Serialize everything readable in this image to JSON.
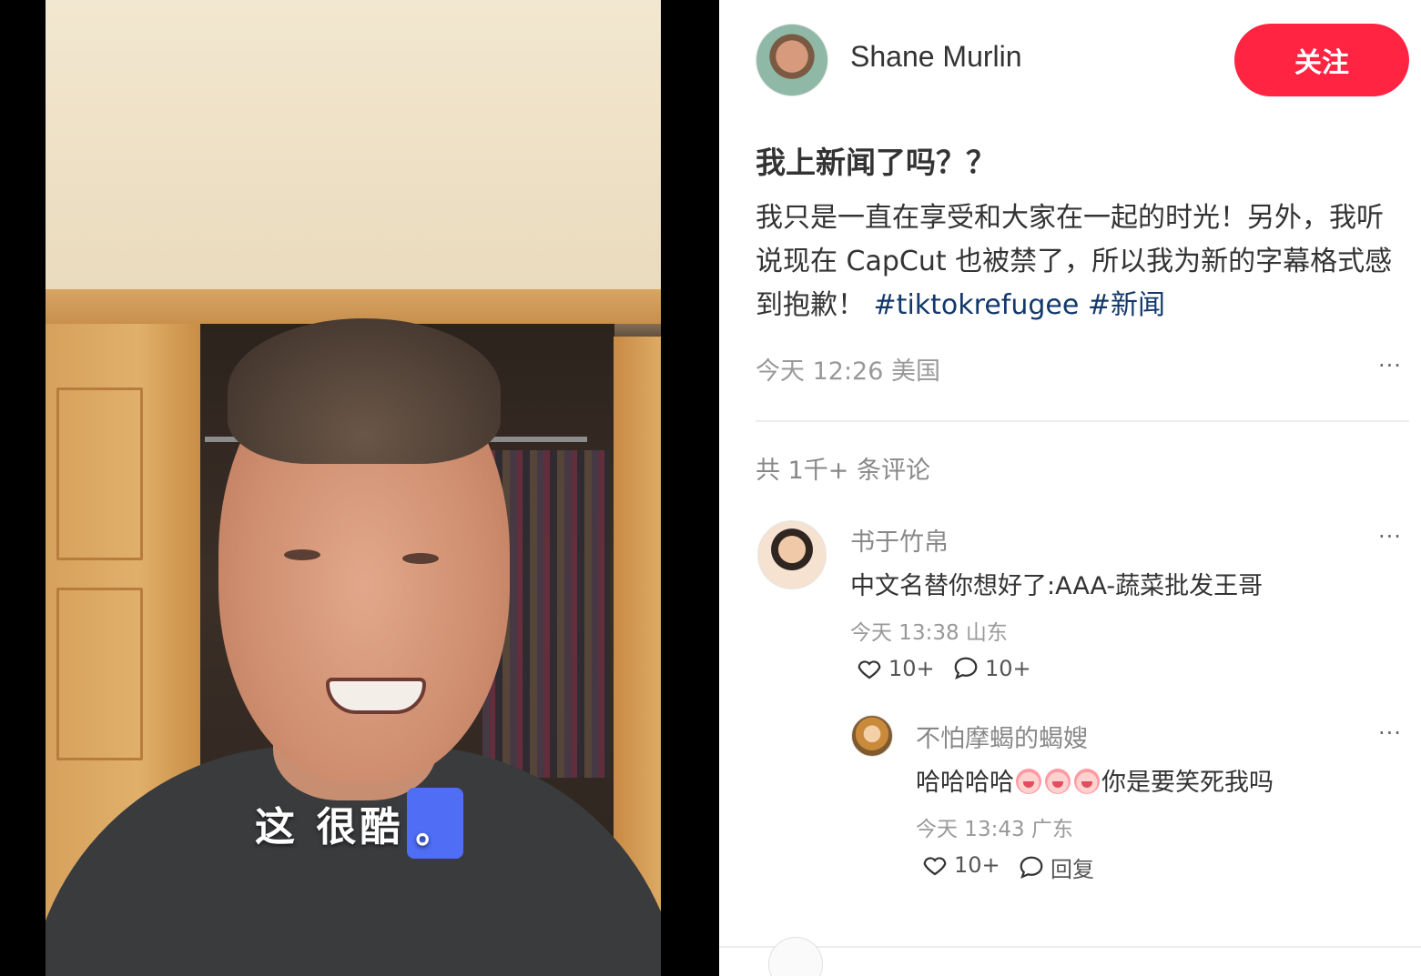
{
  "video": {
    "subtitle": "这 很酷",
    "subtitle_mark": "。"
  },
  "author": {
    "name": "Shane Murlin",
    "follow_label": "关注"
  },
  "post": {
    "title": "我上新闻了吗？？",
    "description": "我只是一直在享受和大家在一起的时光！另外，我听说现在 CapCut 也被禁了，所以我为新的字幕格式感到抱歉！",
    "tags": [
      "#tiktokrefugee",
      "#新闻"
    ],
    "meta": "今天 12:26 美国",
    "more": "···"
  },
  "comments": {
    "count_text": "共 1千+ 条评论",
    "items": [
      {
        "user": "书于竹帛",
        "text": "中文名替你想好了:AAA-蔬菜批发王哥",
        "meta": "今天 13:38 山东",
        "likes": "10+",
        "replies": "10+",
        "more": "···"
      },
      {
        "user": "不怕摩蝎的蝎嫂",
        "text_before": "哈哈哈哈",
        "text_after": "你是要笑死我吗",
        "emoji": "crying-laughing-emoji",
        "meta": "今天 13:43 广东",
        "likes": "10+",
        "reply_label": "回复",
        "more": "···"
      }
    ]
  },
  "colors": {
    "accent": "#ff2442",
    "tag": "#13386c",
    "subtitle_mark_bg": "#4f6df5"
  },
  "icons": {
    "like": "heart-outline-icon",
    "comment": "speech-bubble-icon",
    "more": "ellipsis-icon"
  }
}
